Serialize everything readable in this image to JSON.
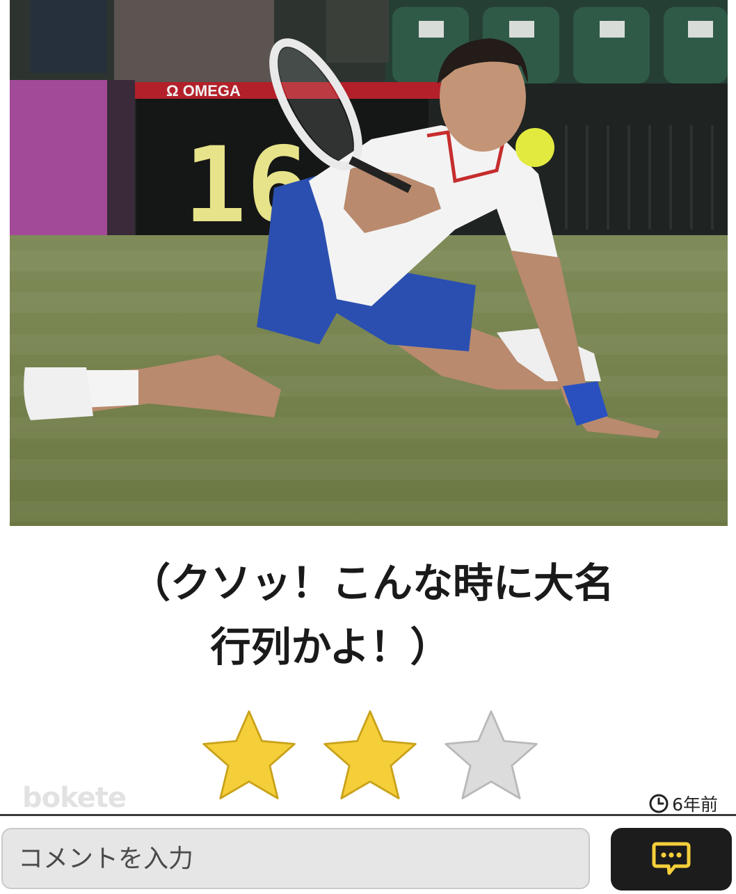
{
  "post": {
    "photo_alt": "",
    "scoreboard_brand": "Ω OMEGA",
    "scoreboard_number": "16",
    "caption_line1": "（クソッ！こんな時に大名",
    "caption_line2": "行列かよ！）"
  },
  "rating": {
    "value": 2,
    "max": 3,
    "filled_color": "#f5cf3a",
    "empty_color": "#dcdcdc"
  },
  "watermark": "bokete",
  "meta": {
    "time_ago": "6年前",
    "clock_icon": "clock-icon"
  },
  "comment": {
    "placeholder": "コメントを入力",
    "value": "",
    "send_icon": "chat-bubble-icon",
    "accent_color": "#f5cf3a"
  }
}
